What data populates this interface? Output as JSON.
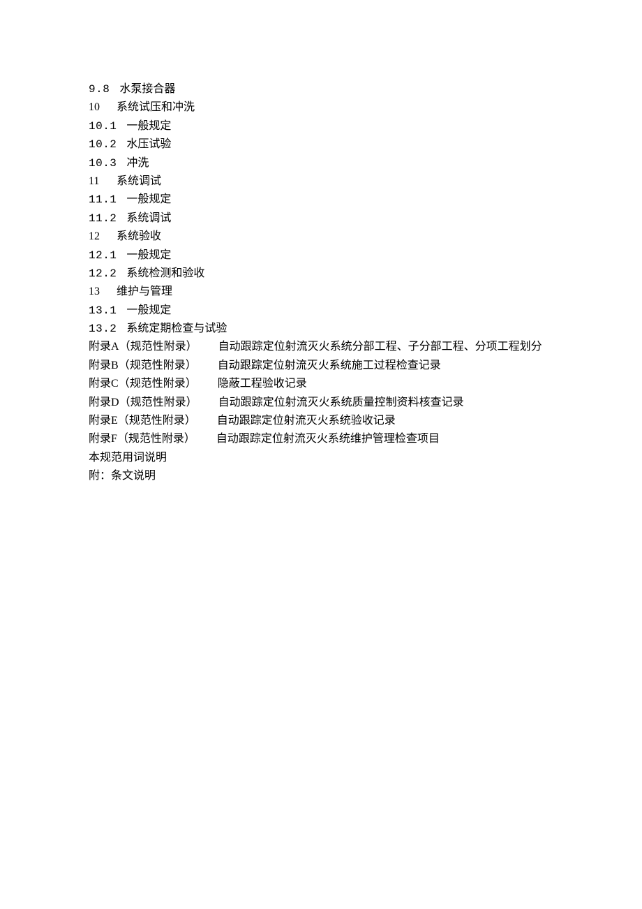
{
  "toc": {
    "sub_9_8": {
      "num": "9.8",
      "title": "水泵接合器"
    },
    "ch_10": {
      "num": "10",
      "title": "系统试压和冲洗"
    },
    "sub_10_1": {
      "num": "10.1",
      "title": "一般规定"
    },
    "sub_10_2": {
      "num": "10.2",
      "title": "水压试验"
    },
    "sub_10_3": {
      "num": "10.3",
      "title": "冲洗"
    },
    "ch_11": {
      "num": "11",
      "title": "系统调试"
    },
    "sub_11_1": {
      "num": "11.1",
      "title": "一般规定"
    },
    "sub_11_2": {
      "num": "11.2",
      "title": "系统调试"
    },
    "ch_12": {
      "num": "12",
      "title": "系统验收"
    },
    "sub_12_1": {
      "num": "12.1",
      "title": "一般规定"
    },
    "sub_12_2": {
      "num": "12.2",
      "title": "系统检测和验收"
    },
    "ch_13": {
      "num": "13",
      "title": "维护与管理"
    },
    "sub_13_1": {
      "num": "13.1",
      "title": "一般规定"
    },
    "sub_13_2": {
      "num": "13.2",
      "title": "系统定期检查与试验"
    },
    "appendix_a": {
      "code": "附录A",
      "hint": "（规范性附录）",
      "title": "自动跟踪定位射流灭火系统分部工程、子分部工程、分项工程划分"
    },
    "appendix_b": {
      "code": "附录B",
      "hint": "（规范性附录）",
      "title": "自动跟踪定位射流灭火系统施工过程检查记录"
    },
    "appendix_c": {
      "code": "附录C",
      "hint": "（规范性附录）",
      "title": "隐蔽工程验收记录"
    },
    "appendix_d": {
      "code": "附录D",
      "hint": "（规范性附录）",
      "title": "自动跟踪定位射流灭火系统质量控制资料核查记录"
    },
    "appendix_e": {
      "code": "附录E",
      "hint": "（规范性附录）",
      "title": "自动跟踪定位射流灭火系统验收记录"
    },
    "appendix_f": {
      "code": "附录F",
      "hint": "（规范性附录）",
      "title": "自动跟踪定位射流灭火系统维护管理检查项目"
    },
    "explain": "本规范用词说明",
    "attach": "附：条文说明"
  }
}
